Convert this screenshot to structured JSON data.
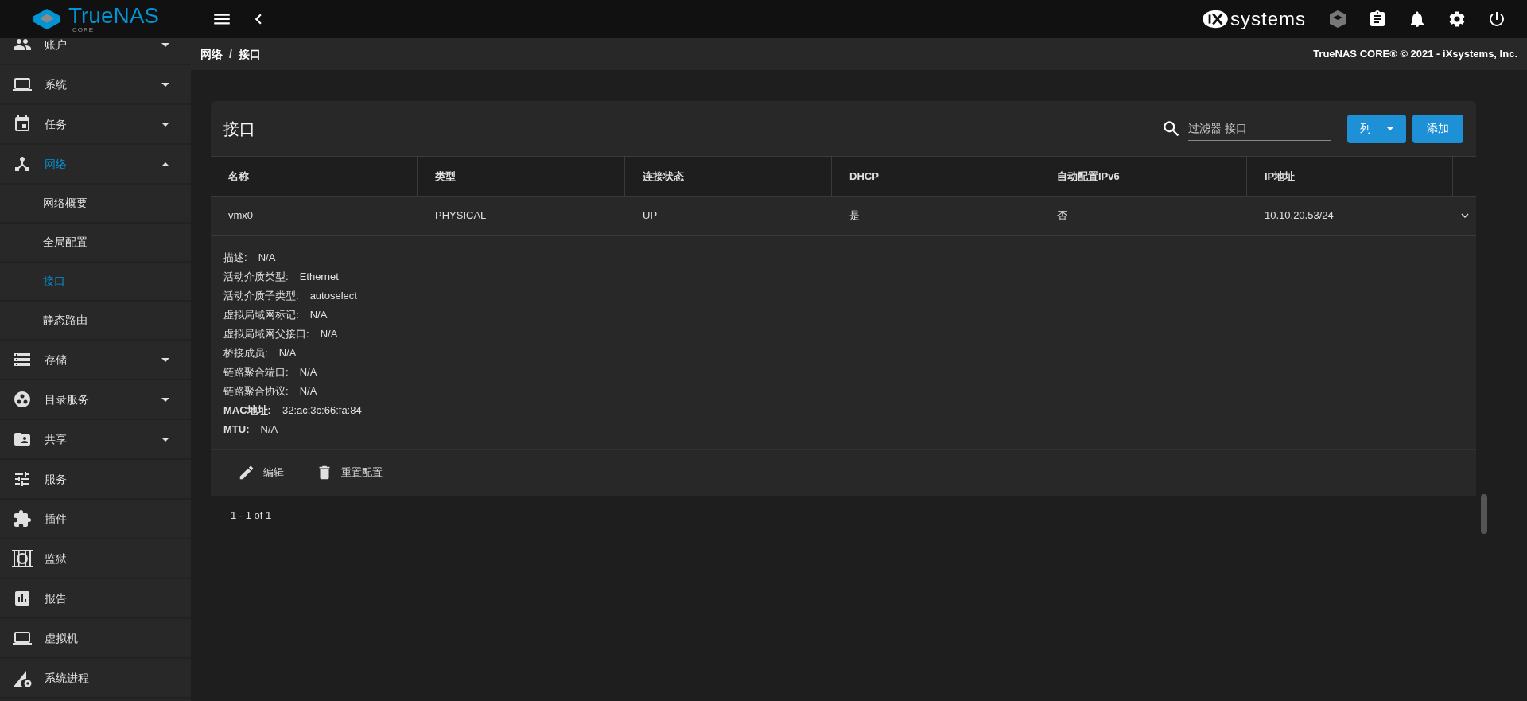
{
  "header": {
    "logo_text": "TrueNAS",
    "logo_sub": "CORE",
    "brand": "systems"
  },
  "sidebar": {
    "items": [
      {
        "label": "账户",
        "selected": false,
        "expanded": false
      },
      {
        "label": "系统",
        "selected": false,
        "expanded": false
      },
      {
        "label": "任务",
        "selected": false,
        "expanded": false
      },
      {
        "label": "网络",
        "selected": true,
        "expanded": true,
        "children": [
          {
            "label": "网络概要",
            "selected": false
          },
          {
            "label": "全局配置",
            "selected": false
          },
          {
            "label": "接口",
            "selected": true
          },
          {
            "label": "静态路由",
            "selected": false
          }
        ]
      },
      {
        "label": "存储",
        "selected": false,
        "expanded": false
      },
      {
        "label": "目录服务",
        "selected": false,
        "expanded": false
      },
      {
        "label": "共享",
        "selected": false,
        "expanded": false
      },
      {
        "label": "服务",
        "selected": false
      },
      {
        "label": "插件",
        "selected": false
      },
      {
        "label": "监狱",
        "selected": false
      },
      {
        "label": "报告",
        "selected": false
      },
      {
        "label": "虚拟机",
        "selected": false
      },
      {
        "label": "系统进程",
        "selected": false
      }
    ]
  },
  "breadcrumb": [
    "网络",
    "接口"
  ],
  "breadcrumb_separator": "/",
  "copyright": "TrueNAS CORE® © 2021 - iXsystems, Inc.",
  "card": {
    "title": "接口",
    "filter": {
      "placeholder": "过滤器 接口"
    },
    "columns_button": "列",
    "add_button": "添加",
    "table": {
      "columns": [
        "名称",
        "类型",
        "连接状态",
        "DHCP",
        "自动配置IPv6",
        "IP地址"
      ],
      "rows": [
        {
          "cells": [
            "vmx0",
            "PHYSICAL",
            "UP",
            "是",
            "否",
            "10.10.20.53/24"
          ],
          "expanded": true,
          "details": [
            {
              "label": "描述:",
              "value": "N/A",
              "bold": false
            },
            {
              "label": "活动介质类型:",
              "value": "Ethernet",
              "bold": false
            },
            {
              "label": "活动介质子类型:",
              "value": "autoselect",
              "bold": false
            },
            {
              "label": "虚拟局域网标记:",
              "value": "N/A",
              "bold": false
            },
            {
              "label": "虚拟局域网父接口:",
              "value": "N/A",
              "bold": false
            },
            {
              "label": "桥接成员:",
              "value": "N/A",
              "bold": false
            },
            {
              "label": "链路聚合端口:",
              "value": "N/A",
              "bold": false
            },
            {
              "label": "链路聚合协议:",
              "value": "N/A",
              "bold": false
            },
            {
              "label": "MAC地址:",
              "value": "32:ac:3c:66:fa:84",
              "bold": true
            },
            {
              "label": "MTU:",
              "value": "N/A",
              "bold": true
            }
          ],
          "actions": [
            {
              "kind": "edit",
              "label": "编辑"
            },
            {
              "kind": "delete",
              "label": "重置配置"
            }
          ]
        }
      ]
    },
    "pagination": "1 - 1 of 1"
  }
}
